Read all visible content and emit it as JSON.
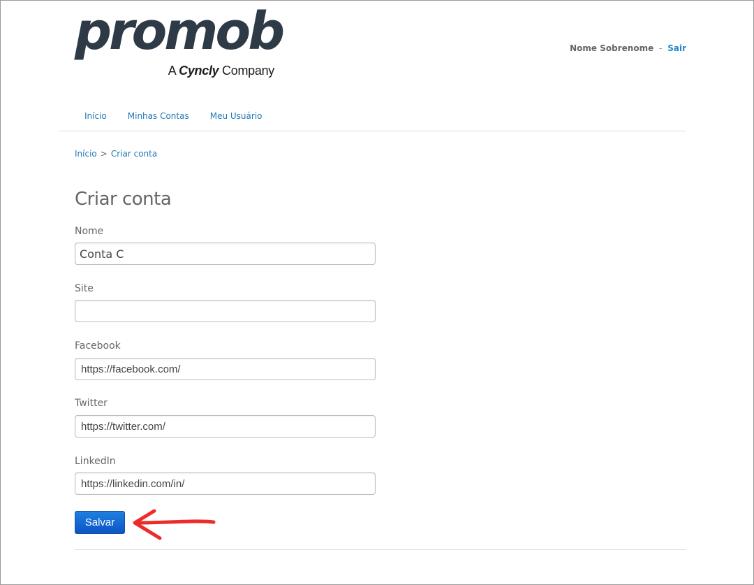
{
  "header": {
    "logo_word": "promob",
    "logo_sub_prefix": "A ",
    "logo_sub_brand": "Cyncly",
    "logo_sub_suffix": " Company",
    "user_name": "Nome Sobrenome",
    "user_separator": "-",
    "logout_label": "Sair"
  },
  "nav": {
    "items": [
      {
        "label": "Início"
      },
      {
        "label": "Minhas Contas"
      },
      {
        "label": "Meu Usuário"
      }
    ]
  },
  "breadcrumb": {
    "home": "Início",
    "separator": ">",
    "current": "Criar conta"
  },
  "form": {
    "title": "Criar conta",
    "fields": [
      {
        "label": "Nome",
        "value": "Conta C"
      },
      {
        "label": "Site",
        "value": ""
      },
      {
        "label": "Facebook",
        "value": "https://facebook.com/"
      },
      {
        "label": "Twitter",
        "value": "https://twitter.com/"
      },
      {
        "label": "LinkedIn",
        "value": "https://linkedin.com/in/"
      }
    ],
    "save_label": "Salvar"
  },
  "colors": {
    "link": "#1e78b4",
    "primary_button": "#0b56c6",
    "annotation_arrow": "#ee2b2b",
    "logo_dark": "#2e3b46"
  }
}
